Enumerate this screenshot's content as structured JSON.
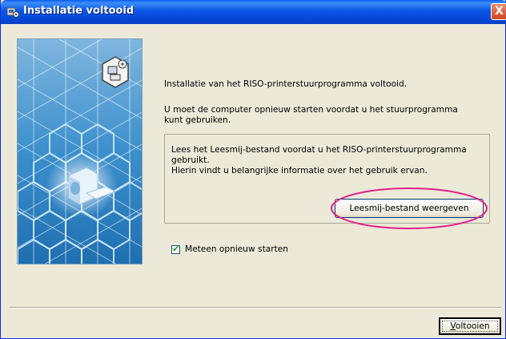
{
  "window": {
    "title": "Installatie voltooid",
    "close_glyph": "X"
  },
  "icons": {
    "title_icon": "installer-icon",
    "side_icon": "printer-computer-icon"
  },
  "content": {
    "line1": "Installatie van het RISO-printerstuurprogramma voltooid.",
    "line2a": "U moet de computer opnieuw starten voordat u het stuurprogramma",
    "line2b": "kunt gebruiken.",
    "group_line1": "Lees het Leesmij-bestand voordat u het RISO-printerstuurprogramma",
    "group_line2": "gebruikt.",
    "group_line3": "Hierin vindt u belangrijke informatie over het gebruik ervan."
  },
  "buttons": {
    "readme_label": "Leesmij-bestand weergeven",
    "finish_label": "Voltooien"
  },
  "restart_checkbox": {
    "label": "Meteen opnieuw starten",
    "checked": true
  },
  "colors": {
    "titlebar": "#0a56e6",
    "highlight": "#e0208a",
    "side_panel": "#2e88c6"
  }
}
